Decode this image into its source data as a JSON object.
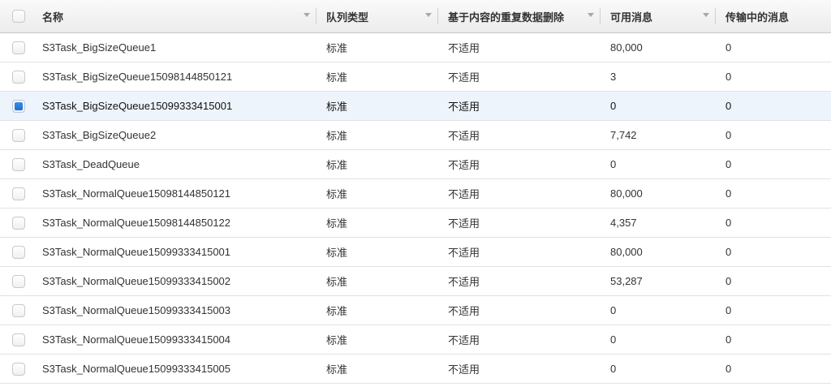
{
  "columns": {
    "name": "名称",
    "type": "队列类型",
    "dedup": "基于内容的重复数据删除",
    "available": "可用消息",
    "inflight": "传输中的消息"
  },
  "rows": [
    {
      "name": "S3Task_BigSizeQueue1",
      "type": "标准",
      "dedup": "不适用",
      "available": "80,000",
      "inflight": "0",
      "selected": false
    },
    {
      "name": "S3Task_BigSizeQueue15098144850121",
      "type": "标准",
      "dedup": "不适用",
      "available": "3",
      "inflight": "0",
      "selected": false
    },
    {
      "name": "S3Task_BigSizeQueue15099333415001",
      "type": "标准",
      "dedup": "不适用",
      "available": "0",
      "inflight": "0",
      "selected": true
    },
    {
      "name": "S3Task_BigSizeQueue2",
      "type": "标准",
      "dedup": "不适用",
      "available": "7,742",
      "inflight": "0",
      "selected": false
    },
    {
      "name": "S3Task_DeadQueue",
      "type": "标准",
      "dedup": "不适用",
      "available": "0",
      "inflight": "0",
      "selected": false
    },
    {
      "name": "S3Task_NormalQueue15098144850121",
      "type": "标准",
      "dedup": "不适用",
      "available": "80,000",
      "inflight": "0",
      "selected": false
    },
    {
      "name": "S3Task_NormalQueue15098144850122",
      "type": "标准",
      "dedup": "不适用",
      "available": "4,357",
      "inflight": "0",
      "selected": false
    },
    {
      "name": "S3Task_NormalQueue15099333415001",
      "type": "标准",
      "dedup": "不适用",
      "available": "80,000",
      "inflight": "0",
      "selected": false
    },
    {
      "name": "S3Task_NormalQueue15099333415002",
      "type": "标准",
      "dedup": "不适用",
      "available": "53,287",
      "inflight": "0",
      "selected": false
    },
    {
      "name": "S3Task_NormalQueue15099333415003",
      "type": "标准",
      "dedup": "不适用",
      "available": "0",
      "inflight": "0",
      "selected": false
    },
    {
      "name": "S3Task_NormalQueue15099333415004",
      "type": "标准",
      "dedup": "不适用",
      "available": "0",
      "inflight": "0",
      "selected": false
    },
    {
      "name": "S3Task_NormalQueue15099333415005",
      "type": "标准",
      "dedup": "不适用",
      "available": "0",
      "inflight": "0",
      "selected": false
    }
  ],
  "colors": {
    "selected_row_bg": "#eef4fb",
    "checkbox_checked": "#1e6fd0",
    "header_bg": "#f2f2f2"
  }
}
